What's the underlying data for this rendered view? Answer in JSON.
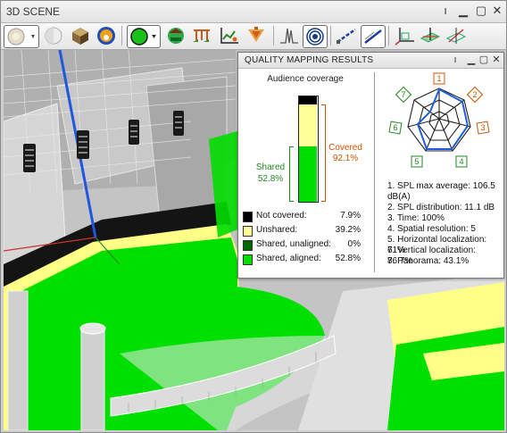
{
  "window": {
    "title": "3D SCENE"
  },
  "panel": {
    "title": "QUALITY MAPPING RESULTS",
    "chart_title": "Audience coverage",
    "covered_label": "Covered",
    "covered_value": "92.1%",
    "shared_label": "Shared",
    "shared_value": "52.8%",
    "coverage": {
      "not_covered": 7.9,
      "unshared": 39.2,
      "shared_unaligned": 0,
      "shared_aligned": 52.8
    },
    "colors": {
      "not_covered": "#000000",
      "unshared": "#ffff99",
      "shared_unaligned": "#006600",
      "shared_aligned": "#00dd00",
      "covered_text": "#cc5500",
      "shared_text": "#228822"
    },
    "legend": [
      {
        "name": "Not covered:",
        "value": "7.9%"
      },
      {
        "name": "Unshared:",
        "value": "39.2%"
      },
      {
        "name": "Shared, unaligned:",
        "value": "0%"
      },
      {
        "name": "Shared, aligned:",
        "value": "52.8%"
      }
    ],
    "radar_labels": [
      "1",
      "2",
      "3",
      "4",
      "5",
      "6",
      "7"
    ],
    "metrics": [
      "1. SPL max average: 106.5",
      "dB(A)",
      "2. SPL distribution: 11.1 dB",
      "3. Time: 100%",
      "4. Spatial resolution: 5",
      "5. Horizontal localization: 71%",
      "6. Vertical localization: 86.7%",
      "7. Panorama: 43.1%"
    ]
  },
  "toolbar_icons": [
    "light-source-icon",
    "dropdown-icon",
    "sphere-icon",
    "box-icon",
    "coverage-source-icon",
    "coverage-mode-icon",
    "dropdown-icon",
    "venue-icon",
    "speaker-array-icon",
    "seating-icon",
    "chart-icon",
    "speaker-cone-icon",
    "spectrum-icon",
    "target-icon",
    "line-tool-icon",
    "line-tool-2-icon",
    "axis-icon",
    "plane-icon",
    "plane-axis-icon"
  ]
}
